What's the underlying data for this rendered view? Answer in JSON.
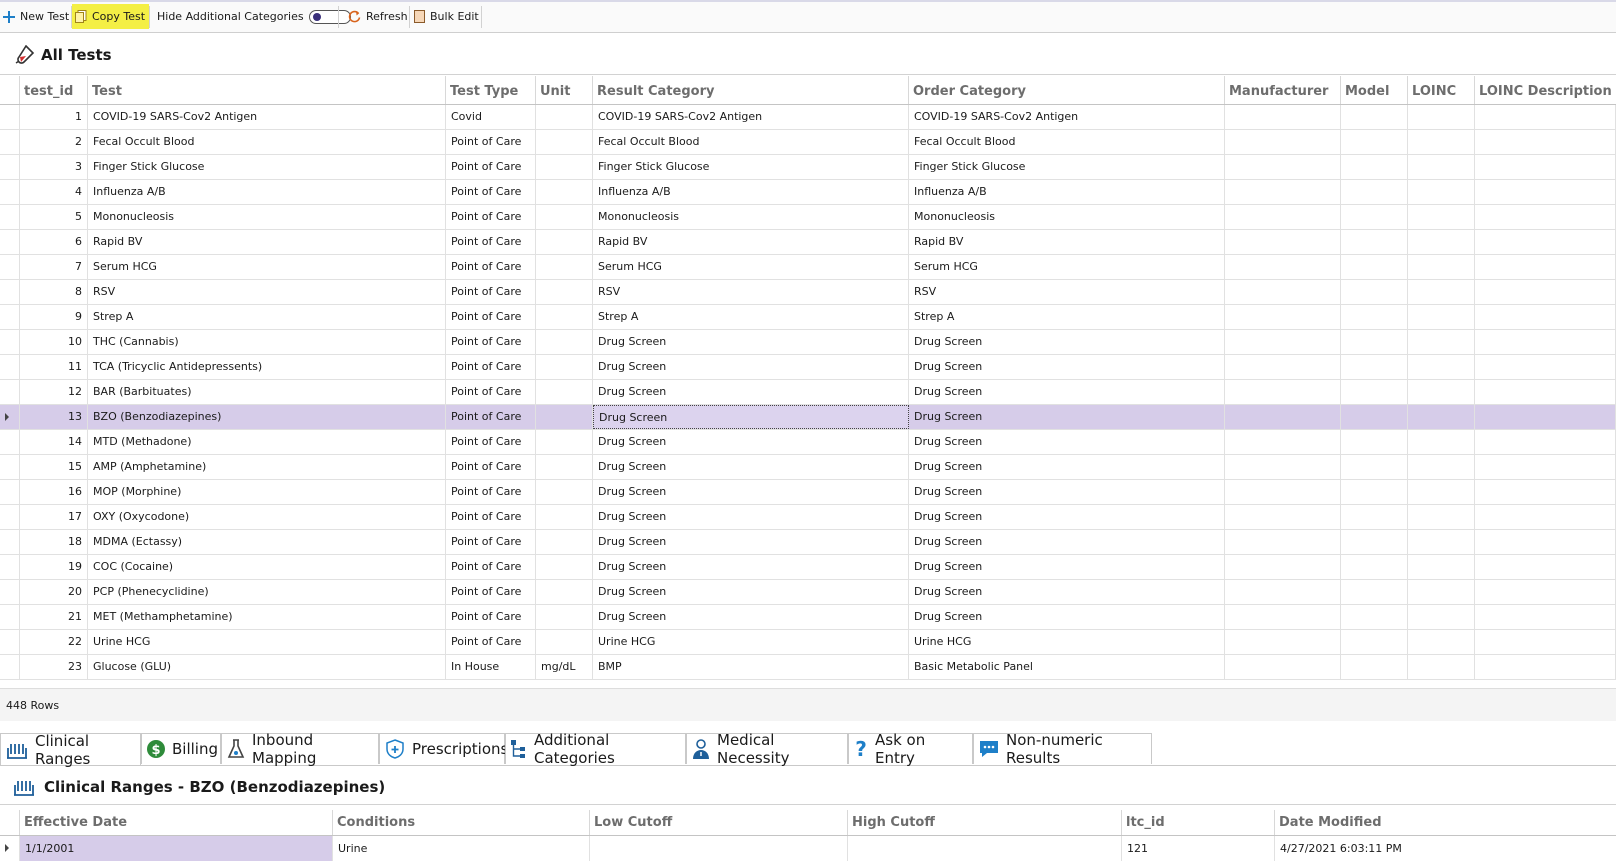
{
  "toolbar": {
    "new_test": "New Test",
    "copy_test": "Copy Test",
    "hide_additional": "Hide Additional Categories",
    "refresh": "Refresh",
    "bulk_edit": "Bulk Edit"
  },
  "main": {
    "title": "All Tests",
    "columns": [
      "test_id",
      "Test",
      "Test Type",
      "Unit",
      "Result Category",
      "Order Category",
      "Manufacturer",
      "Model",
      "LOINC",
      "LOINC Description"
    ],
    "rows": [
      {
        "id": "1",
        "test": "COVID-19 SARS-Cov2 Antigen",
        "type": "Covid",
        "unit": "",
        "result": "COVID-19 SARS-Cov2 Antigen",
        "order": "COVID-19 SARS-Cov2 Antigen"
      },
      {
        "id": "2",
        "test": "Fecal Occult Blood",
        "type": "Point of Care",
        "unit": "",
        "result": "Fecal Occult Blood",
        "order": "Fecal Occult Blood"
      },
      {
        "id": "3",
        "test": "Finger Stick Glucose",
        "type": "Point of Care",
        "unit": "",
        "result": "Finger Stick Glucose",
        "order": "Finger Stick Glucose"
      },
      {
        "id": "4",
        "test": "Influenza A/B",
        "type": "Point of Care",
        "unit": "",
        "result": "Influenza A/B",
        "order": "Influenza A/B"
      },
      {
        "id": "5",
        "test": "Mononucleosis",
        "type": "Point of Care",
        "unit": "",
        "result": "Mononucleosis",
        "order": "Mononucleosis"
      },
      {
        "id": "6",
        "test": "Rapid BV",
        "type": "Point of Care",
        "unit": "",
        "result": "Rapid BV",
        "order": "Rapid BV"
      },
      {
        "id": "7",
        "test": "Serum HCG",
        "type": "Point of Care",
        "unit": "",
        "result": "Serum HCG",
        "order": "Serum HCG"
      },
      {
        "id": "8",
        "test": "RSV",
        "type": "Point of Care",
        "unit": "",
        "result": "RSV",
        "order": "RSV"
      },
      {
        "id": "9",
        "test": "Strep A",
        "type": "Point of Care",
        "unit": "",
        "result": "Strep A",
        "order": "Strep A"
      },
      {
        "id": "10",
        "test": "THC (Cannabis)",
        "type": "Point of Care",
        "unit": "",
        "result": "Drug Screen",
        "order": "Drug Screen"
      },
      {
        "id": "11",
        "test": "TCA (Tricyclic Antidepressents)",
        "type": "Point of Care",
        "unit": "",
        "result": "Drug Screen",
        "order": "Drug Screen"
      },
      {
        "id": "12",
        "test": "BAR (Barbituates)",
        "type": "Point of Care",
        "unit": "",
        "result": "Drug Screen",
        "order": "Drug Screen"
      },
      {
        "id": "13",
        "test": "BZO (Benzodiazepines)",
        "type": "Point of Care",
        "unit": "",
        "result": "Drug Screen",
        "order": "Drug Screen"
      },
      {
        "id": "14",
        "test": "MTD (Methadone)",
        "type": "Point of Care",
        "unit": "",
        "result": "Drug Screen",
        "order": "Drug Screen"
      },
      {
        "id": "15",
        "test": "AMP (Amphetamine)",
        "type": "Point of Care",
        "unit": "",
        "result": "Drug Screen",
        "order": "Drug Screen"
      },
      {
        "id": "16",
        "test": "MOP (Morphine)",
        "type": "Point of Care",
        "unit": "",
        "result": "Drug Screen",
        "order": "Drug Screen"
      },
      {
        "id": "17",
        "test": "OXY (Oxycodone)",
        "type": "Point of Care",
        "unit": "",
        "result": "Drug Screen",
        "order": "Drug Screen"
      },
      {
        "id": "18",
        "test": "MDMA (Ectassy)",
        "type": "Point of Care",
        "unit": "",
        "result": "Drug Screen",
        "order": "Drug Screen"
      },
      {
        "id": "19",
        "test": "COC (Cocaine)",
        "type": "Point of Care",
        "unit": "",
        "result": "Drug Screen",
        "order": "Drug Screen"
      },
      {
        "id": "20",
        "test": "PCP (Phenecyclidine)",
        "type": "Point of Care",
        "unit": "",
        "result": "Drug Screen",
        "order": "Drug Screen"
      },
      {
        "id": "21",
        "test": "MET (Methamphetamine)",
        "type": "Point of Care",
        "unit": "",
        "result": "Drug Screen",
        "order": "Drug Screen"
      },
      {
        "id": "22",
        "test": "Urine HCG",
        "type": "Point of Care",
        "unit": "",
        "result": "Urine HCG",
        "order": "Urine HCG"
      },
      {
        "id": "23",
        "test": "Glucose (GLU)",
        "type": "In House",
        "unit": "mg/dL",
        "result": "BMP",
        "order": "Basic Metabolic Panel"
      }
    ],
    "row_count": "448 Rows"
  },
  "tabs": [
    "Clinical Ranges",
    "Billing",
    "Inbound Mapping",
    "Prescriptions",
    "Additional Categories",
    "Medical Necessity",
    "Ask on Entry",
    "Non-numeric Results"
  ],
  "detail": {
    "title": "Clinical Ranges - BZO (Benzodiazepines)",
    "columns": [
      "Effective Date",
      "Conditions",
      "Low Cutoff",
      "High Cutoff",
      "ltc_id",
      "Date Modified"
    ],
    "row": {
      "effective": "1/1/2001",
      "conditions": "Urine",
      "low": "",
      "high": "",
      "ltc_id": "121",
      "modified": "4/27/2021 6:03:11 PM"
    }
  },
  "colors": {
    "selection": "#d6cce9",
    "highlight": "#f4ef45",
    "accent": "#1e7fc8"
  }
}
